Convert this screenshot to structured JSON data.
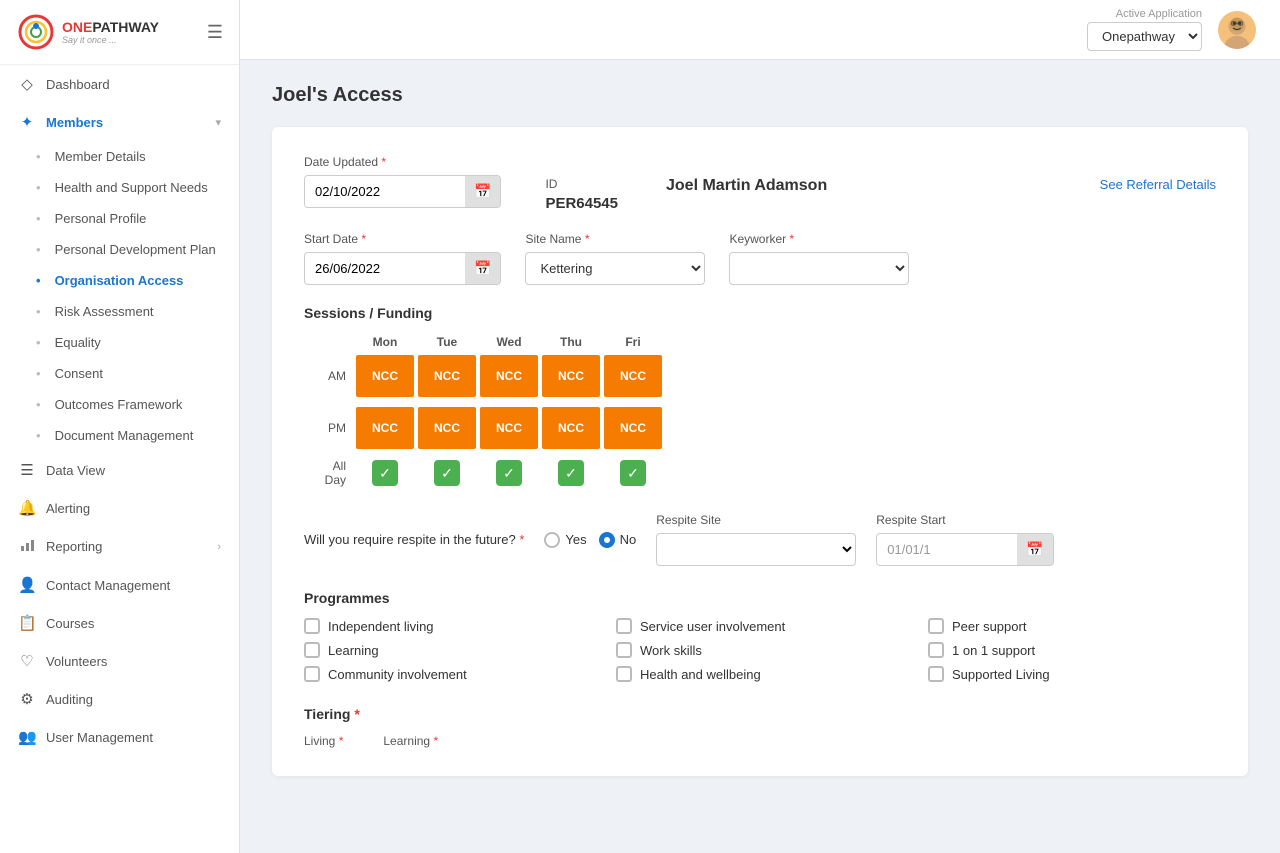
{
  "sidebar": {
    "logo": {
      "brand": "ONEPATHWAY",
      "tagline": "Say it once ...",
      "hamburger": "☰"
    },
    "nav": [
      {
        "id": "dashboard",
        "label": "Dashboard",
        "icon": "◇",
        "active": false
      },
      {
        "id": "members",
        "label": "Members",
        "icon": "✦",
        "active": true,
        "expanded": true,
        "chevron": "▾"
      },
      {
        "id": "member-details",
        "label": "Member Details",
        "sub": true,
        "active": false
      },
      {
        "id": "health-support",
        "label": "Health and Support Needs",
        "sub": true,
        "active": false
      },
      {
        "id": "personal-profile",
        "label": "Personal Profile",
        "sub": true,
        "active": false
      },
      {
        "id": "personal-dev",
        "label": "Personal Development Plan",
        "sub": true,
        "active": false
      },
      {
        "id": "org-access",
        "label": "Organisation Access",
        "sub": true,
        "active": true
      },
      {
        "id": "risk-assessment",
        "label": "Risk Assessment",
        "sub": true,
        "active": false
      },
      {
        "id": "equality",
        "label": "Equality",
        "sub": true,
        "active": false
      },
      {
        "id": "consent",
        "label": "Consent",
        "sub": true,
        "active": false
      },
      {
        "id": "outcomes-framework",
        "label": "Outcomes Framework",
        "sub": true,
        "active": false
      },
      {
        "id": "document-mgmt",
        "label": "Document Management",
        "sub": true,
        "active": false
      },
      {
        "id": "data-view",
        "label": "Data View",
        "icon": "☰",
        "active": false
      },
      {
        "id": "alerting",
        "label": "Alerting",
        "icon": "🔔",
        "active": false
      },
      {
        "id": "reporting",
        "label": "Reporting",
        "icon": "📊",
        "active": false,
        "chevron": "›"
      },
      {
        "id": "contact-mgmt",
        "label": "Contact Management",
        "icon": "👤",
        "active": false
      },
      {
        "id": "courses",
        "label": "Courses",
        "icon": "📋",
        "active": false
      },
      {
        "id": "volunteers",
        "label": "Volunteers",
        "icon": "♡",
        "active": false
      },
      {
        "id": "auditing",
        "label": "Auditing",
        "icon": "⚙",
        "active": false
      },
      {
        "id": "user-mgmt",
        "label": "User Management",
        "icon": "👥",
        "active": false
      }
    ]
  },
  "topbar": {
    "active_app_label": "Active Application",
    "app_options": [
      "Onepathway"
    ],
    "app_selected": "Onepathway"
  },
  "page": {
    "title": "Joel's Access"
  },
  "form": {
    "date_updated_label": "Date Updated",
    "date_updated_value": "02/10/2022",
    "id_label": "ID",
    "id_value": "PER64545",
    "person_name": "Joel Martin Adamson",
    "see_referral": "See Referral Details",
    "start_date_label": "Start Date",
    "start_date_value": "26/06/2022",
    "site_name_label": "Site Name",
    "site_name_value": "Kettering",
    "site_options": [
      "Kettering"
    ],
    "keyworker_label": "Keyworker",
    "keyworker_value": "",
    "sessions_title": "Sessions / Funding",
    "days": [
      "Mon",
      "Tue",
      "Wed",
      "Thu",
      "Fri"
    ],
    "periods": [
      "AM",
      "PM"
    ],
    "sessions": {
      "AM": [
        "NCC",
        "NCC",
        "NCC",
        "NCC",
        "NCC"
      ],
      "PM": [
        "NCC",
        "NCC",
        "NCC",
        "NCC",
        "NCC"
      ],
      "AllDay": [
        true,
        true,
        true,
        true,
        true
      ]
    },
    "respite_question": "Will you require respite in the future?",
    "respite_required": false,
    "respite_yes": "Yes",
    "respite_no": "No",
    "respite_site_label": "Respite Site",
    "respite_start_label": "Respite Start",
    "respite_start_value": "01/01/1",
    "programmes_title": "Programmes",
    "programmes": [
      "Independent living",
      "Service user involvement",
      "Peer support",
      "Learning",
      "Work skills",
      "1 on 1 support",
      "Community involvement",
      "Health and wellbeing",
      "Supported Living"
    ],
    "tiering_title": "Tiering",
    "living_label": "Living",
    "learning_label": "Learning"
  }
}
